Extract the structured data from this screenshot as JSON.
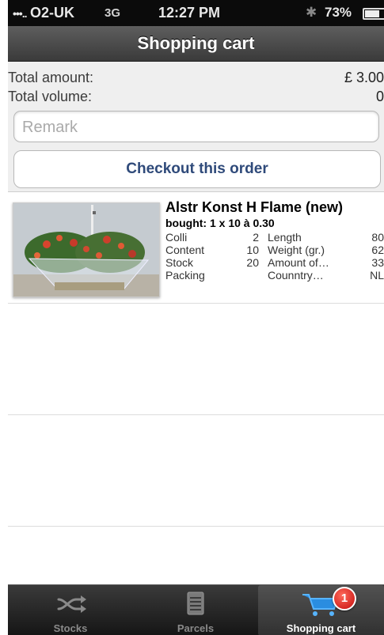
{
  "status_bar": {
    "signal": "•••.. ",
    "carrier": "O2-UK",
    "network": "3G",
    "time": "12:27 PM",
    "bluetooth": "✱",
    "battery": "73%"
  },
  "nav": {
    "title": "Shopping cart"
  },
  "summary": {
    "total_amount_label": "Total amount:",
    "total_amount_value": "£ 3.00",
    "total_volume_label": "Total volume:",
    "total_volume_value": "0",
    "remark_placeholder": "Remark",
    "checkout_label": "Checkout this order"
  },
  "items": [
    {
      "name": "Alstr Konst H Flame (new)",
      "bought": "bought: 1 x 10 à 0.30",
      "specs_left": [
        {
          "label": "Colli",
          "value": "2"
        },
        {
          "label": "Content",
          "value": "10"
        },
        {
          "label": "Stock",
          "value": "20"
        },
        {
          "label": "Packing",
          "value": ""
        }
      ],
      "specs_right": [
        {
          "label": "Length",
          "value": "80"
        },
        {
          "label": "Weight (gr.)",
          "value": "62"
        },
        {
          "label": "Amount of…",
          "value": "33"
        },
        {
          "label": "Counntry…",
          "value": "NL"
        }
      ]
    }
  ],
  "tabs": [
    {
      "label": "Stocks",
      "icon": "shuffle-icon"
    },
    {
      "label": "Parcels",
      "icon": "document-icon"
    },
    {
      "label": "Shopping cart",
      "icon": "cart-icon",
      "badge": "1",
      "active": true
    }
  ],
  "colors": {
    "accent_text": "#2f4a7a",
    "badge": "#d41a1a",
    "nav_bar": "#4a4a4a"
  }
}
